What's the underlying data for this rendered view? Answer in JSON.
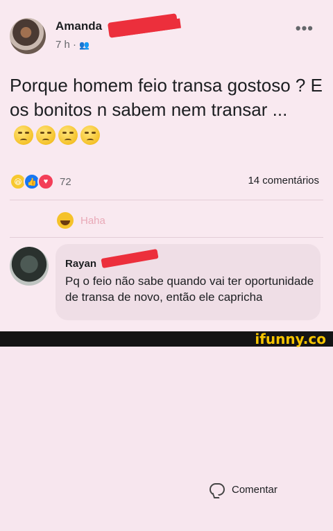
{
  "post": {
    "author": "Amanda",
    "time": "7 h ·",
    "privacy_icon": "friends-icon",
    "more_label": "•••",
    "text": "Porque homem feio transa gostoso ? E os bonitos n sabem nem transar ...",
    "emojis": [
      "worried-face",
      "worried-face",
      "worried-face",
      "worried-face"
    ]
  },
  "stats": {
    "reaction_icons": [
      "haha",
      "like",
      "love"
    ],
    "reaction_count": "72",
    "comments": "14 comentários"
  },
  "actions": {
    "haha_label": "Haha",
    "comment_label": "Comentar"
  },
  "comment": {
    "author": "Rayan",
    "text": "Pq o feio não sabe quando vai ter oportunidade de transa de novo, então ele capricha"
  },
  "watermark": "ifunny.co",
  "colors": {
    "background": "#f9e9f0",
    "redaction": "#ec2f3c",
    "haha_text": "#e9a9b7",
    "watermark": "#f5c400"
  }
}
